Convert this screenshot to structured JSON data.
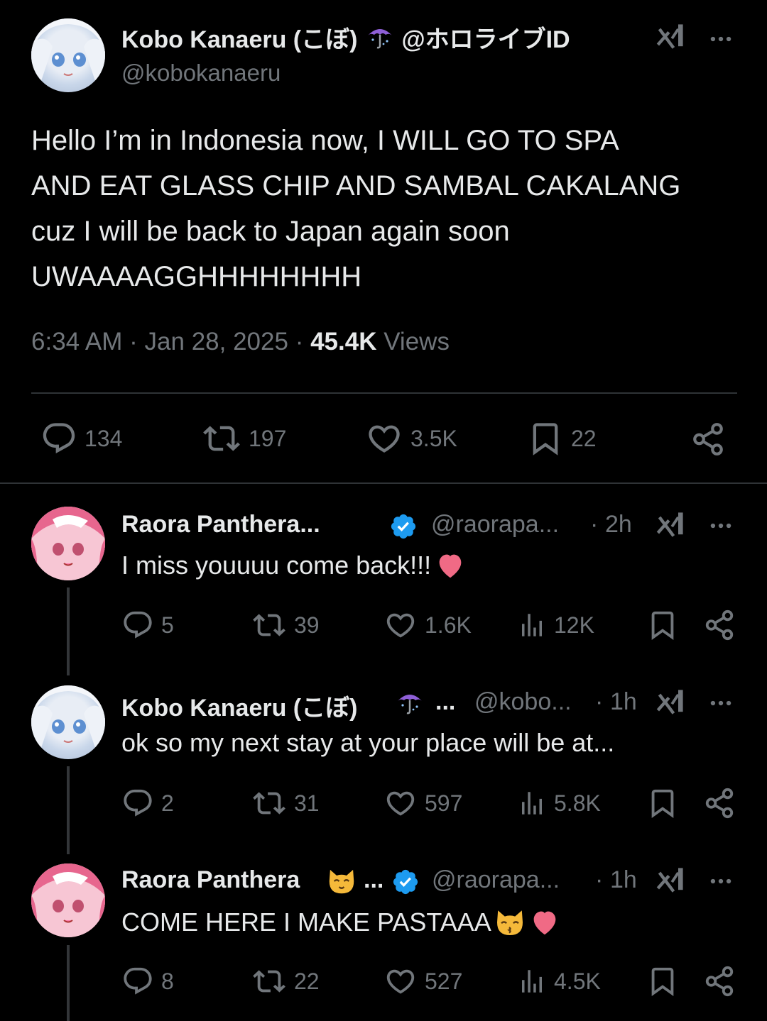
{
  "main_tweet": {
    "author_name": "Kobo Kanaeru (こぼ)",
    "author_name_suffix": "@ホロライブID",
    "author_handle": "@kobokanaeru",
    "text_lines": [
      "Hello I’m in Indonesia now, I WILL GO TO SPA",
      "AND EAT GLASS CHIP AND SAMBAL CAKALANG",
      "cuz I will be back to Japan again soon",
      "UWAAAAGGHHHHHHHH"
    ],
    "time": "6:34 AM",
    "date": "Jan 28, 2025",
    "views_count": "45.4K",
    "views_label": "Views",
    "stats": {
      "replies": "134",
      "reposts": "197",
      "likes": "3.5K",
      "bookmarks": "22"
    }
  },
  "replies": [
    {
      "name": "Raora Panthera...",
      "handle": "@raorapa...",
      "time": "2h",
      "text": "I miss youuuu come back!!!",
      "stats": {
        "replies": "5",
        "reposts": "39",
        "likes": "1.6K",
        "views": "12K"
      }
    },
    {
      "name": "Kobo Kanaeru (こぼ)",
      "name_ellipsis": "...",
      "handle": "@kobo...",
      "time": "1h",
      "text": "ok so my next stay at your place will be at...",
      "stats": {
        "replies": "2",
        "reposts": "31",
        "likes": "597",
        "views": "5.8K"
      }
    },
    {
      "name": "Raora Panthera",
      "name_ellipsis": "...",
      "handle": "@raorapa...",
      "time": "1h",
      "text": "COME HERE I MAKE PASTAAA",
      "stats": {
        "replies": "8",
        "reposts": "22",
        "likes": "527",
        "views": "4.5K"
      }
    }
  ],
  "separator": "·",
  "colors": {
    "background": "#000000",
    "text": "#e7e9ea",
    "muted": "#71767b",
    "verified": "#1d9bf0",
    "heart_emoji": "#f06a85",
    "divider": "#2f3336"
  },
  "icons": [
    "umbrella-icon",
    "grok-icon",
    "more-icon",
    "reply-icon",
    "repost-icon",
    "like-icon",
    "bookmark-icon",
    "share-icon",
    "views-icon",
    "verified-icon",
    "cat-face-icon",
    "kissing-cat-icon",
    "heart-emoji-icon"
  ]
}
